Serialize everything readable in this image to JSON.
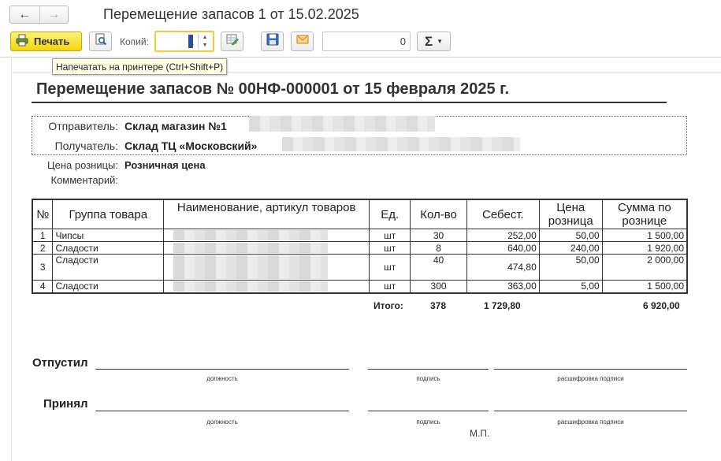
{
  "window": {
    "title": "Перемещение запасов 1 от 15.02.2025"
  },
  "toolbar": {
    "print_label": "Печать",
    "copies_label": "Копий:",
    "copies_value": "1",
    "sum_value": "0",
    "sum_symbol": "Σ",
    "tooltip": "Напечатать на принтере (Ctrl+Shift+P)"
  },
  "document": {
    "title": "Перемещение запасов № 00НФ-000001 от 15 февраля 2025 г.",
    "sender_label": "Отправитель:",
    "sender_value": "Склад магазин №1",
    "receiver_label": "Получатель:",
    "receiver_value": "Склад ТЦ «Московский»",
    "price_label": "Цена розницы:",
    "price_value": "Розничная цена",
    "comment_label": "Комментарий:",
    "columns": [
      "№",
      "Группа товара",
      "Наименование, артикул товаров",
      "Ед.",
      "Кол-во",
      "Себест.",
      "Цена розница",
      "Сумма по рознице"
    ],
    "rows": [
      {
        "n": "1",
        "group": "Чипсы",
        "unit": "шт",
        "qty": "30",
        "cost": "252,00",
        "price": "50,00",
        "sum": "1 500,00"
      },
      {
        "n": "2",
        "group": "Сладости",
        "unit": "шт",
        "qty": "8",
        "cost": "640,00",
        "price": "240,00",
        "sum": "1 920,00"
      },
      {
        "n": "3",
        "group": "Сладости",
        "unit": "шт",
        "qty": "40",
        "cost": "474,80",
        "price": "50,00",
        "sum": "2 000,00"
      },
      {
        "n": "4",
        "group": "Сладости",
        "unit": "шт",
        "qty": "300",
        "cost": "363,00",
        "price": "5,00",
        "sum": "1 500,00"
      }
    ],
    "totals": {
      "label": "Итого:",
      "qty": "378",
      "cost": "1 729,80",
      "sum": "6 920,00"
    },
    "signatures": {
      "released_label": "Отпустил",
      "received_label": "Принял",
      "position_caption": "должность",
      "signature_caption": "подпись",
      "decode_caption": "расшифровка подписи",
      "stamp": "М.П."
    }
  },
  "colors": {
    "print_button": "#f3d40c",
    "focus_border": "#f1cc3a",
    "tooltip_bg": "#ffffe6"
  }
}
